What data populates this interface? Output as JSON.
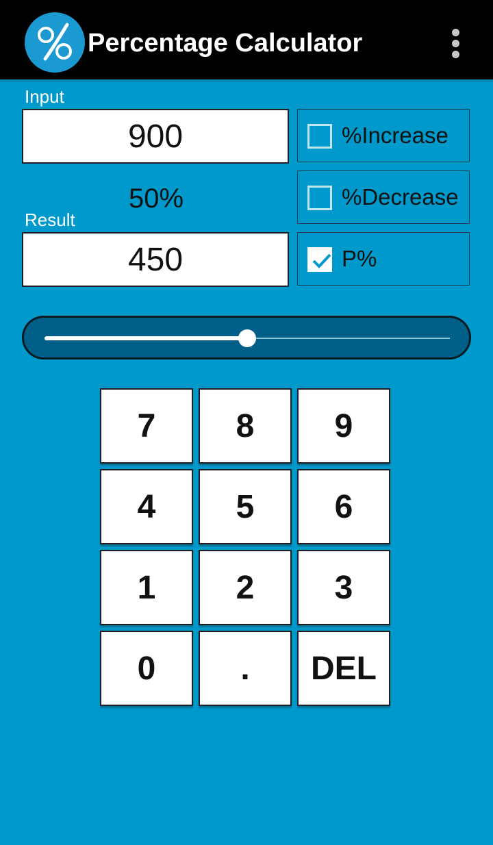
{
  "appbar": {
    "title": "Percentage Calculator",
    "logo_icon": "percent-logo-icon",
    "menu_icon": "overflow-menu-icon",
    "background": "#000000"
  },
  "theme": {
    "background": "#0099cc",
    "slider_track": "#005f88"
  },
  "input": {
    "label": "Input",
    "value": "900"
  },
  "percentage": {
    "value": "50%"
  },
  "result": {
    "label": "Result",
    "value": "450"
  },
  "options": [
    {
      "label": "%Increase",
      "checked": false
    },
    {
      "label": "%Decrease",
      "checked": false
    },
    {
      "label": "P%",
      "checked": true
    }
  ],
  "slider": {
    "value_fraction": 0.5
  },
  "keypad": {
    "keys": [
      "7",
      "8",
      "9",
      "4",
      "5",
      "6",
      "1",
      "2",
      "3",
      "0",
      ".",
      "DEL"
    ]
  }
}
